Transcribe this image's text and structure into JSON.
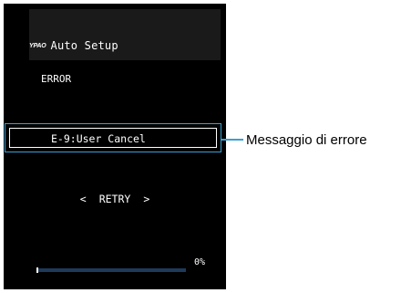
{
  "screen": {
    "logo": "YPAO",
    "title": "Auto Setup",
    "status": "ERROR",
    "message": "E-9:User Cancel",
    "nav_left": "<",
    "option": "RETRY",
    "nav_right": ">",
    "progress_text": "0%",
    "progress_fraction": 0.0
  },
  "annotation": {
    "callout_label": "Messaggio di errore",
    "highlight_color": "#3aa0d2"
  }
}
